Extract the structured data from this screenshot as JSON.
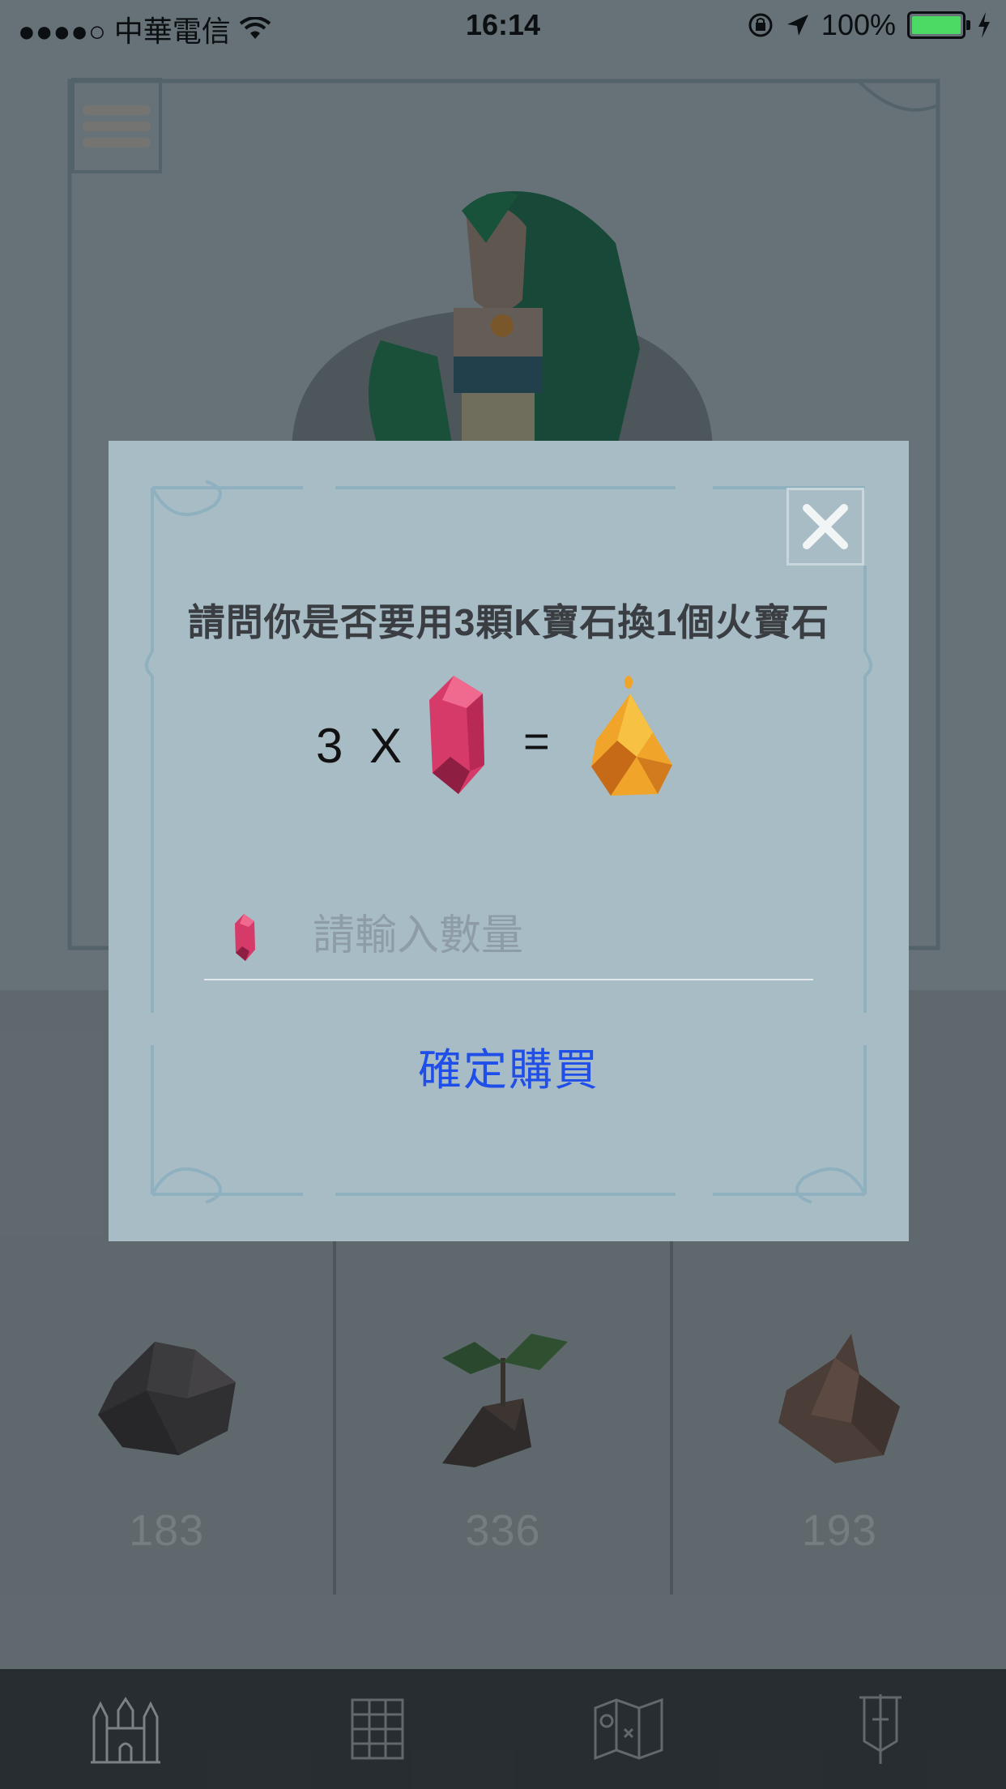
{
  "status_bar": {
    "carrier": "●●●●○ 中華電信",
    "time": "16:14",
    "battery_text": "100%",
    "battery_level": 1.0
  },
  "inventory": {
    "items": [
      {
        "name": "rock",
        "count": "183",
        "icon": "coal-rock-icon"
      },
      {
        "name": "sprout",
        "count": "336",
        "icon": "sprout-icon"
      },
      {
        "name": "wood",
        "count": "193",
        "icon": "wood-log-icon"
      }
    ]
  },
  "dialog": {
    "title": "請問你是否要用3顆K寶石換1個火寶石",
    "equation": {
      "quantity": "3",
      "times": "X",
      "equals": "=",
      "from_icon": "k-gem-icon",
      "to_icon": "fire-gem-icon"
    },
    "quantity_placeholder": "請輸入數量",
    "confirm_label": "確定購買",
    "close_icon": "close-icon"
  },
  "tabbar": {
    "tabs": [
      {
        "icon": "castle-icon",
        "active": true
      },
      {
        "icon": "grid-icon",
        "active": false
      },
      {
        "icon": "map-icon",
        "active": false
      },
      {
        "icon": "banner-icon",
        "active": false
      }
    ]
  },
  "colors": {
    "dialog_bg": "#a8bcc6",
    "confirm_blue": "#1f4ee8",
    "gem_red": "#d63a68",
    "fire_orange": "#f0a52a",
    "tabbar_bg": "#2c3033"
  }
}
